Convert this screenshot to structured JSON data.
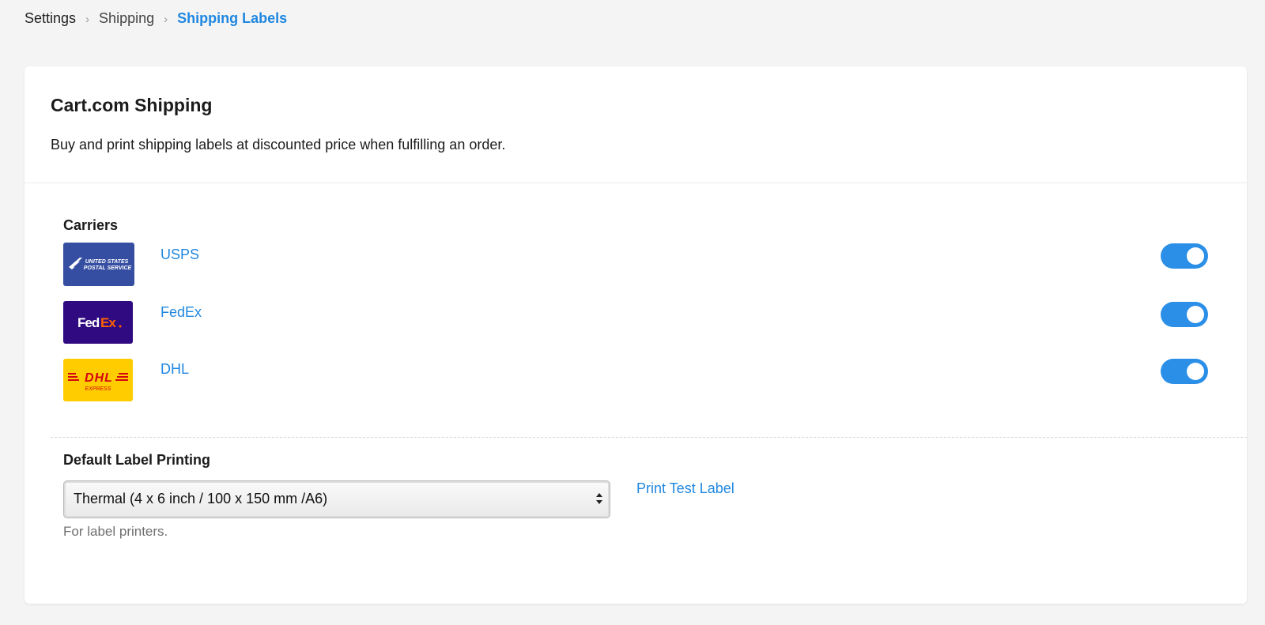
{
  "breadcrumb": {
    "items": [
      "Settings",
      "Shipping",
      "Shipping Labels"
    ],
    "separator": "›"
  },
  "card": {
    "title": "Cart.com Shipping",
    "description": "Buy and print shipping labels at discounted price when fulfilling an order."
  },
  "carriers": {
    "label": "Carriers",
    "items": [
      {
        "name": "USPS",
        "enabled": true,
        "logo_text": [
          "UNITED STATES",
          "POSTAL SERVICE"
        ],
        "logo_color": "#354ea1"
      },
      {
        "name": "FedEx",
        "enabled": true,
        "logo_text": [
          "Fed",
          "Ex"
        ],
        "logo_color": "#2f0a80"
      },
      {
        "name": "DHL",
        "enabled": true,
        "logo_text": [
          "DHL",
          "EXPRESS"
        ],
        "logo_color": "#ffcc00"
      }
    ]
  },
  "printing": {
    "label": "Default Label Printing",
    "selected": "Thermal (4 x 6 inch / 100 x 150 mm /A6)",
    "hint": "For label printers.",
    "test_link": "Print Test Label"
  },
  "colors": {
    "accent": "#1f87e0",
    "toggle_on": "#2b8fe8",
    "fedex_orange": "#ff6200",
    "dhl_red": "#d40511"
  }
}
